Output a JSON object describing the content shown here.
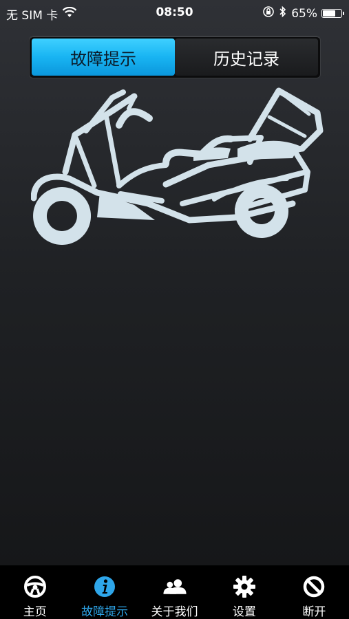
{
  "status_bar": {
    "carrier": "无 SIM 卡",
    "time": "08:50",
    "battery": "65%",
    "battery_level": 0.65,
    "icons": [
      "wifi-icon",
      "orientation-lock-icon",
      "bluetooth-icon",
      "battery-icon"
    ]
  },
  "segmented": {
    "tabs": [
      {
        "label": "故障提示",
        "active": true
      },
      {
        "label": "历史记录",
        "active": false
      }
    ]
  },
  "illustration": {
    "icon": "motorcycle-icon"
  },
  "tab_bar": {
    "items": [
      {
        "label": "主页",
        "icon": "steering-wheel-icon",
        "active": false
      },
      {
        "label": "故障提示",
        "icon": "info-icon",
        "active": true
      },
      {
        "label": "关于我们",
        "icon": "users-icon",
        "active": false
      },
      {
        "label": "设置",
        "icon": "gear-icon",
        "active": false
      },
      {
        "label": "断开",
        "icon": "disconnect-icon",
        "active": false
      }
    ]
  },
  "colors": {
    "accent": "#2ea6ea",
    "illustration": "#d3e2ea",
    "tab_bar_bg": "#000000"
  }
}
